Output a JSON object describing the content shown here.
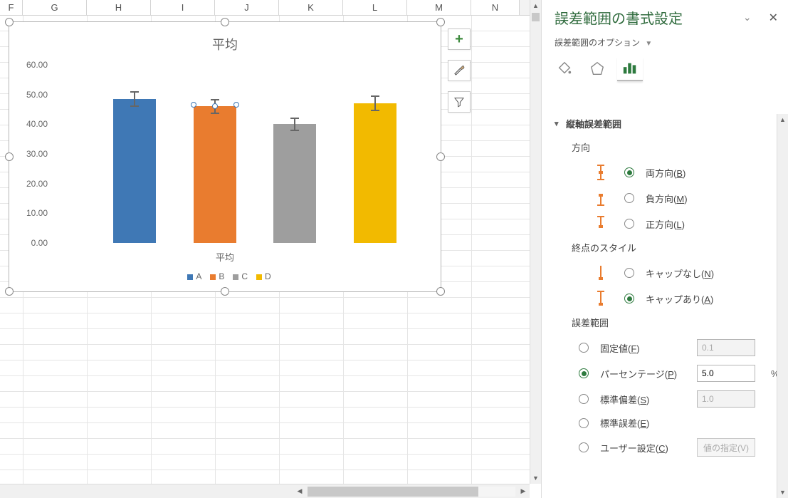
{
  "columns": [
    "F",
    "G",
    "H",
    "I",
    "J",
    "K",
    "L",
    "M",
    "N"
  ],
  "chart_buttons": {
    "add": "+",
    "style": "brush",
    "filter": "funnel"
  },
  "chart_data": {
    "type": "bar",
    "title": "平均",
    "xlabel": "平均",
    "categories": [
      "A",
      "B",
      "C",
      "D"
    ],
    "values": [
      48.5,
      46.0,
      40.0,
      47.0
    ],
    "colors": [
      "#3f78b5",
      "#e97c2f",
      "#9e9e9e",
      "#f2ba00"
    ],
    "error_percent": 5.0,
    "yticks": [
      "0.00",
      "10.00",
      "20.00",
      "30.00",
      "40.00",
      "50.00",
      "60.00"
    ],
    "ylim": [
      0,
      60
    ],
    "legend": [
      "A",
      "B",
      "C",
      "D"
    ]
  },
  "pane": {
    "title": "誤差範囲の書式設定",
    "subtitle": "誤差範囲のオプション",
    "section": "縦軸誤差範囲",
    "direction": {
      "label": "方向",
      "options": [
        {
          "key": "B",
          "text": "両方向",
          "checked": true
        },
        {
          "key": "M",
          "text": "負方向",
          "checked": false
        },
        {
          "key": "L",
          "text": "正方向",
          "checked": false
        }
      ]
    },
    "endstyle": {
      "label": "終点のスタイル",
      "options": [
        {
          "key": "N",
          "text": "キャップなし",
          "checked": false
        },
        {
          "key": "A",
          "text": "キャップあり",
          "checked": true
        }
      ]
    },
    "amount": {
      "label": "誤差範囲",
      "options": [
        {
          "key": "F",
          "text": "固定値",
          "value": "0.1",
          "enabled": false,
          "checked": false,
          "suffix": ""
        },
        {
          "key": "P",
          "text": "パーセンテージ",
          "value": "5.0",
          "enabled": true,
          "checked": true,
          "suffix": "%"
        },
        {
          "key": "S",
          "text": "標準偏差",
          "value": "1.0",
          "enabled": false,
          "checked": false,
          "suffix": ""
        },
        {
          "key": "E",
          "text": "標準誤差",
          "value": "",
          "enabled": false,
          "checked": false,
          "suffix": ""
        },
        {
          "key": "C",
          "text": "ユーザー設定",
          "value": "値の指定(V)",
          "enabled": false,
          "checked": false,
          "suffix": "",
          "isButton": true
        }
      ]
    }
  }
}
